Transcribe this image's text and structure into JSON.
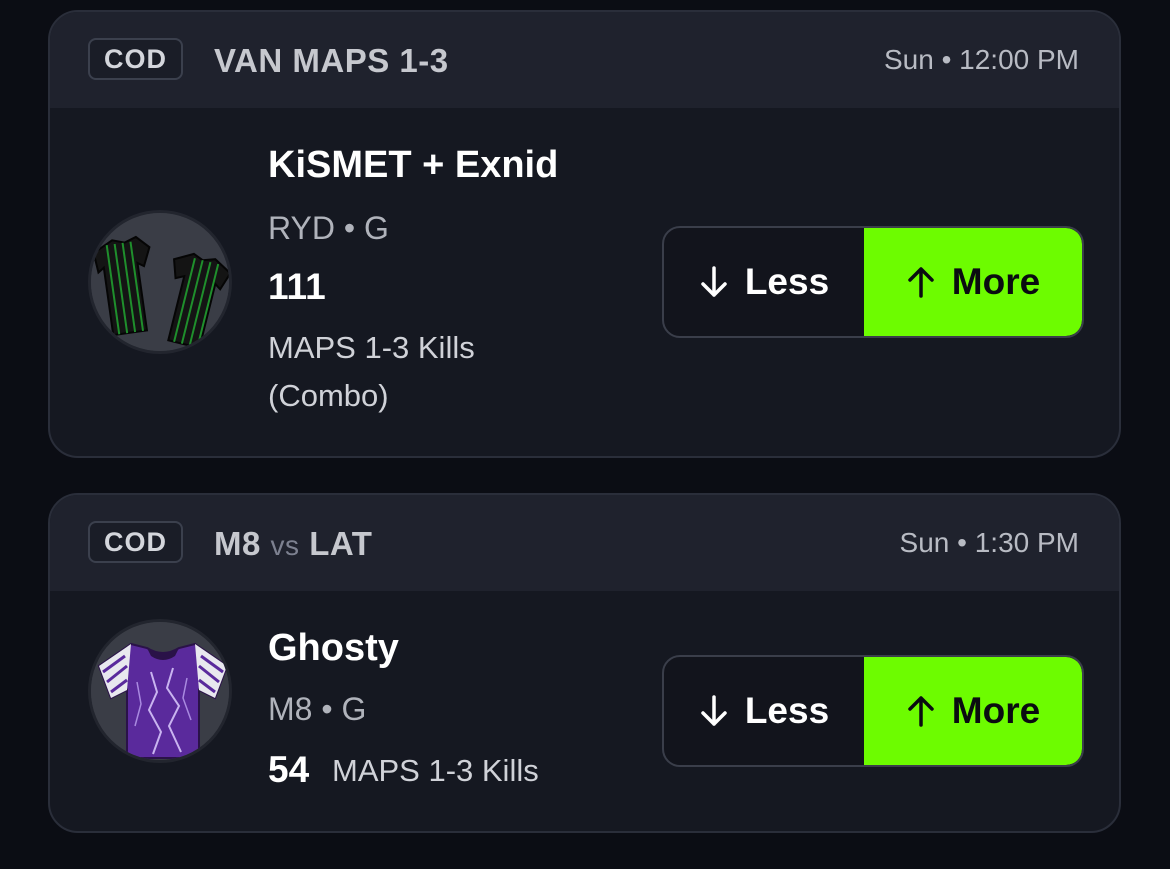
{
  "cards": [
    {
      "league": "COD",
      "matchup_text": "VAN MAPS 1-3",
      "time": "Sun • 12:00 PM",
      "player_name": "KiSMET + Exnid",
      "team_pos": "RYD • G",
      "line": "111",
      "stat": "MAPS 1-3 Kills (Combo)",
      "less_label": "Less",
      "more_label": "More",
      "jersey_icon": "jersey-black-green-icon"
    },
    {
      "league": "COD",
      "team_a": "M8",
      "vs": "vs",
      "team_b": "LAT",
      "time": "Sun • 1:30 PM",
      "player_name": "Ghosty",
      "team_pos": "M8 • G",
      "line": "54",
      "stat": "MAPS 1-3 Kills",
      "less_label": "Less",
      "more_label": "More",
      "jersey_icon": "jersey-purple-icon"
    }
  ],
  "colors": {
    "background": "#0b0d14",
    "card": "#151821",
    "header": "#1f222d",
    "more_accent": "#6dfc00"
  }
}
